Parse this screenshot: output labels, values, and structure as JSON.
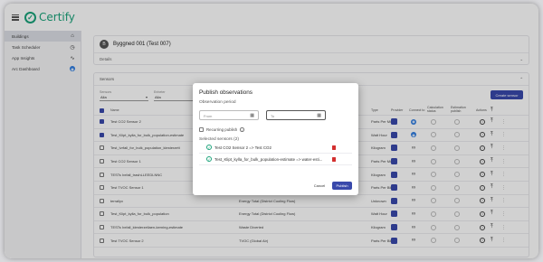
{
  "app": {
    "name": "Certify"
  },
  "sidebar": {
    "items": [
      {
        "label": "Buildings",
        "icon": "house-icon"
      },
      {
        "label": "Task Scheduler",
        "icon": "clock-icon"
      },
      {
        "label": "App Insights",
        "icon": "chart-icon"
      },
      {
        "label": "Arc Dashboard",
        "icon": "badge-icon"
      }
    ]
  },
  "building": {
    "avatar": "B",
    "title": "Byggned 001 (Test 007)",
    "details_label": "Details"
  },
  "sensors": {
    "section_label": "Sensors",
    "filter1": {
      "label": "Sensors",
      "value": "Alla"
    },
    "filter2": {
      "label": "Enheter",
      "value": "Alla"
    },
    "create_button": "Create sensor",
    "columns": {
      "name": "Name",
      "type": "Type",
      "provider": "Provider",
      "connect": "Connect to",
      "calc1": "Calculation status",
      "calc2": "Estimation publish",
      "actions": "Actions"
    },
    "rows": [
      {
        "name": "Test CO2 Sensor 2",
        "device": "",
        "type": "Parts Per Million",
        "checked": true,
        "connect": "blue"
      },
      {
        "name": "Test_Klipt_kylla_for_bulk_population-estimate",
        "device": "",
        "type": "Watt Hour",
        "checked": true,
        "connect": "blue"
      },
      {
        "name": "Test_Ivrfall_for_bulk_population_klesterzett",
        "device": "",
        "type": "Kilogram",
        "checked": false,
        "connect": "link"
      },
      {
        "name": "Test CO2 Sensor 1",
        "device": "",
        "type": "Parts Per Million",
        "checked": false,
        "connect": "link"
      },
      {
        "name": "TESTs Ivrfall_trashLLEEDLNNC",
        "device": "",
        "type": "Kilogram",
        "checked": false,
        "connect": "link"
      },
      {
        "name": "Test TVOC Sensor 1",
        "device": "",
        "type": "Parts Per Billion",
        "checked": false,
        "connect": "link"
      },
      {
        "name": "terrallyx",
        "device": "Energy Total (District Cooling Flow)",
        "type": "Unknown",
        "checked": false,
        "connect": "link"
      },
      {
        "name": "Test_Klipt_kylla_for_bulk_population",
        "device": "Energy Total (District Cooling Flow)",
        "type": "Watt Hour",
        "checked": false,
        "connect": "link"
      },
      {
        "name": "TESTs Ivrfall_klesterzellaen-kerning-estimate",
        "device": "Waste Diverted",
        "type": "Kilogram",
        "checked": false,
        "connect": "link"
      },
      {
        "name": "Test TVOC Sensor 2",
        "device": "TVOC (Global Air)",
        "type": "Parts Per Billion",
        "checked": false,
        "connect": "link"
      }
    ]
  },
  "modal": {
    "title": "Publish observations",
    "period_label": "Observation period",
    "from_label": "From",
    "to_label": "To",
    "recurring_label": "Recurring publish",
    "selected_title": "Selected sensors (2)",
    "selected": [
      "Test CO2 Sensor 2 => Test CO2",
      "Test_Klipt_kylla_for_bulk_population-estimate => water-esti..."
    ],
    "cancel_label": "Cancel",
    "publish_label": "Publish"
  },
  "colors": {
    "brand": "#1aa37a",
    "primary": "#3949ab",
    "danger": "#d32f2f"
  }
}
